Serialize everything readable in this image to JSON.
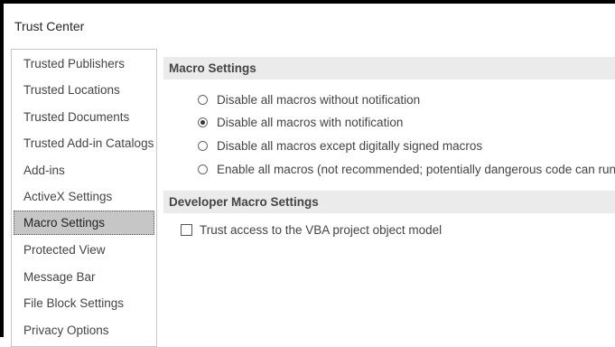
{
  "window": {
    "title": "Trust Center"
  },
  "sidebar": {
    "selected_index": 6,
    "items": [
      {
        "label": "Trusted Publishers"
      },
      {
        "label": "Trusted Locations"
      },
      {
        "label": "Trusted Documents"
      },
      {
        "label": "Trusted Add-in Catalogs"
      },
      {
        "label": "Add-ins"
      },
      {
        "label": "ActiveX Settings"
      },
      {
        "label": "Macro Settings"
      },
      {
        "label": "Protected View"
      },
      {
        "label": "Message Bar"
      },
      {
        "label": "File Block Settings"
      },
      {
        "label": "Privacy Options"
      }
    ]
  },
  "macro_settings": {
    "header": "Macro Settings",
    "selected_option": 1,
    "options": [
      {
        "label": "Disable all macros without notification"
      },
      {
        "label": "Disable all macros with notification"
      },
      {
        "label": "Disable all macros except digitally signed macros"
      },
      {
        "label": "Enable all macros (not recommended; potentially dangerous code can run)"
      }
    ]
  },
  "developer_macro_settings": {
    "header": "Developer Macro Settings",
    "trust_vba_label": "Trust access to the VBA project object model",
    "trust_vba_checked": false
  },
  "colors": {
    "selected_item_bg": "#c6c6c6",
    "section_header_bg": "#ebebeb",
    "text": "#444444",
    "border": "#c8c8c8"
  }
}
